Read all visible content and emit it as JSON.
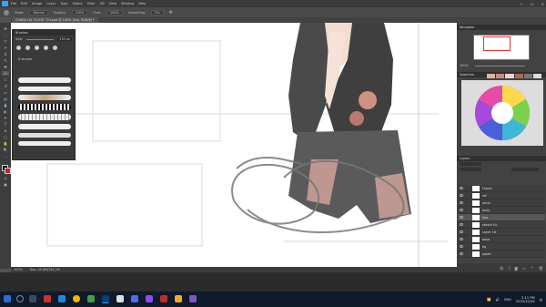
{
  "menubar": {
    "items": [
      "File",
      "Edit",
      "Image",
      "Layer",
      "Type",
      "Select",
      "Filter",
      "3D",
      "View",
      "Window",
      "Help"
    ]
  },
  "window_controls": {
    "minimize": "—",
    "maximize": "☐",
    "close": "✕"
  },
  "options_bar": {
    "mode_label": "Mode:",
    "mode_value": "Normal",
    "opacity_label": "Opacity:",
    "opacity_value": "100%",
    "flow_label": "Flow:",
    "flow_value": "100%",
    "smoothing_label": "Smoothing:",
    "smoothing_value": "0%"
  },
  "document": {
    "tab_title": "CHARA LUL FLOOR 723.psd @ 100% (line, RGB/8) *"
  },
  "brushes_panel": {
    "title": "Brushes",
    "size_label": "Size:",
    "size_value": "135 px",
    "folder_label": "8 strokes"
  },
  "status_bar": {
    "zoom": "100%",
    "doc_info": "Doc: 45.8M/764.2M"
  },
  "navigator": {
    "title": "Navigator",
    "zoom": "100%"
  },
  "swatches": {
    "title": "Swatches"
  },
  "layers": {
    "title": "Layers",
    "items": [
      {
        "name": "Frame",
        "selected": false
      },
      {
        "name": "ref",
        "selected": false
      },
      {
        "name": "arms",
        "selected": false
      },
      {
        "name": "body",
        "selected": false
      },
      {
        "name": "line",
        "selected": true
      },
      {
        "name": "sketch Eu",
        "selected": false
      },
      {
        "name": "Layer 18",
        "selected": false
      },
      {
        "name": "base",
        "selected": false
      },
      {
        "name": "bg",
        "selected": false
      },
      {
        "name": "paper",
        "selected": false
      }
    ]
  },
  "taskbar": {
    "language": "ENG",
    "time": "2:11 PM",
    "date": "2020/10/28"
  },
  "colors": {
    "ps_blue": "#31a8ff",
    "panel_dark": "#3a3a3a",
    "taskbar": "#0f1a2b",
    "selected_layer": "#575757"
  }
}
